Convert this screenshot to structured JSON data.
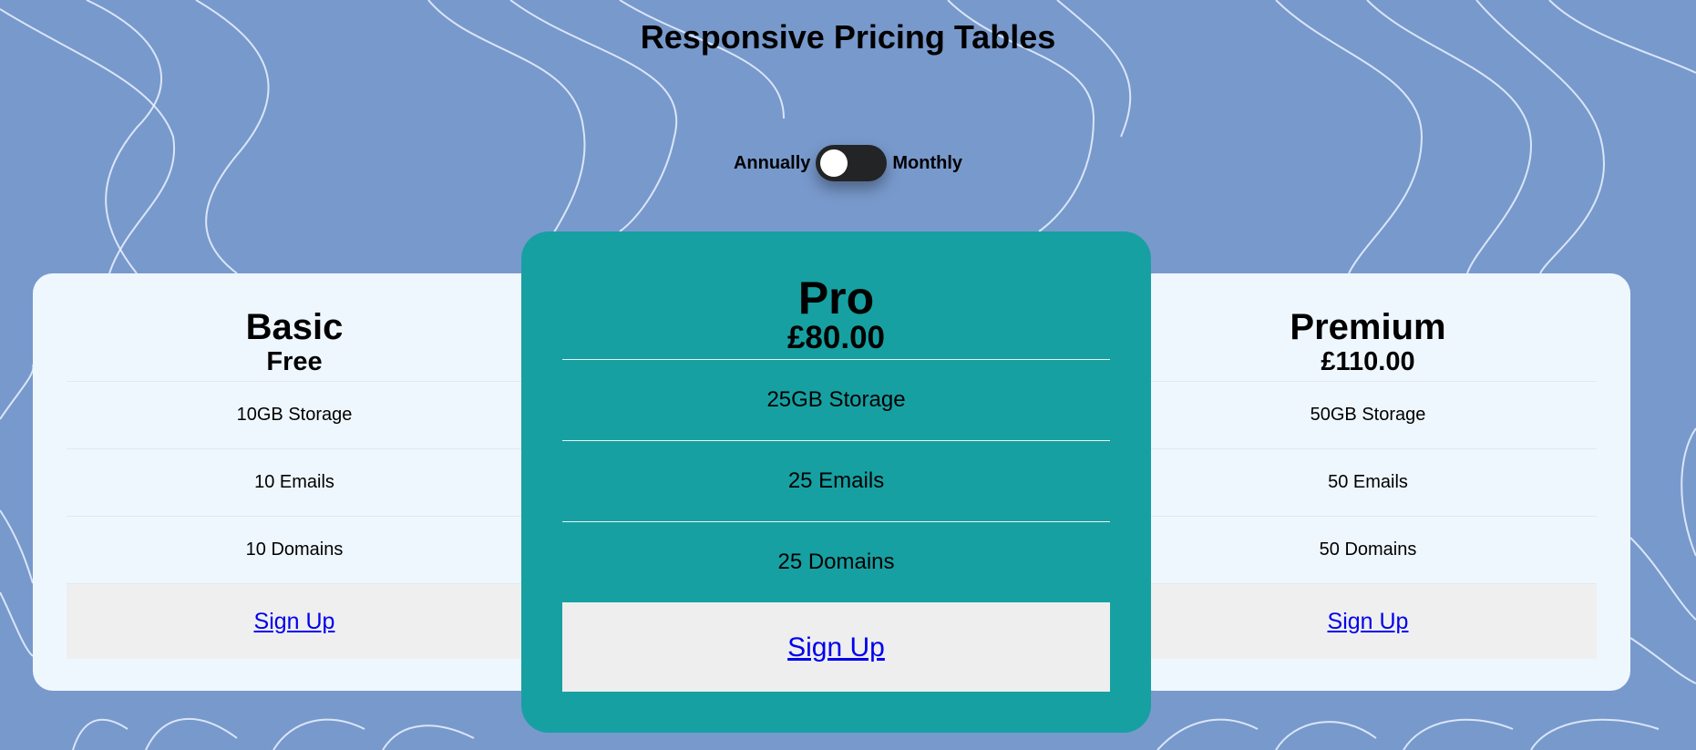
{
  "page": {
    "title": "Responsive Pricing Tables"
  },
  "toggle": {
    "left_label": "Annually",
    "right_label": "Monthly",
    "state": "annually"
  },
  "colors": {
    "background": "#7899cc",
    "card": "#eff7fe",
    "featured_card": "#17a0a2",
    "switch": "#222426",
    "signup_bg": "#efefef",
    "link": "#0000ee"
  },
  "plans": [
    {
      "name": "Basic",
      "price": "Free",
      "features": [
        "10GB Storage",
        "10 Emails",
        "10 Domains"
      ],
      "cta": "Sign Up"
    },
    {
      "name": "Pro",
      "price": "£80.00",
      "features": [
        "25GB Storage",
        "25 Emails",
        "25 Domains"
      ],
      "cta": "Sign Up"
    },
    {
      "name": "Premium",
      "price": "£110.00",
      "features": [
        "50GB Storage",
        "50 Emails",
        "50 Domains"
      ],
      "cta": "Sign Up"
    }
  ]
}
